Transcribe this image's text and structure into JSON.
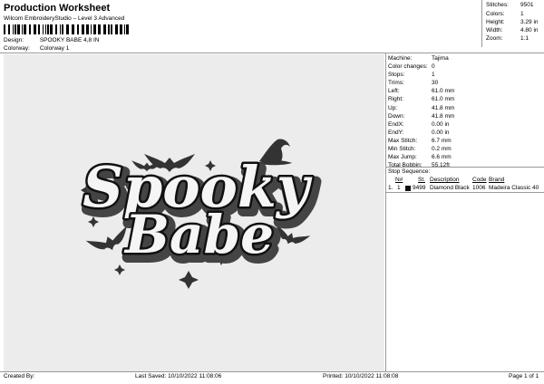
{
  "header": {
    "title": "Production Worksheet",
    "subtitle": "Wilcom EmbroideryStudio – Level 3 Advanced",
    "design_label": "Design:",
    "design_value": "SPOOKY BABE 4,8 IN",
    "colorway_label": "Colorway:",
    "colorway_value": "Colorway 1"
  },
  "summary": {
    "stitches_label": "Stitches:",
    "stitches": "9501",
    "colors_label": "Colors:",
    "colors": "1",
    "height_label": "Height:",
    "height": "3.29 in",
    "width_label": "Width:",
    "width": "4.80 in",
    "zoom_label": "Zoom:",
    "zoom": "1:1"
  },
  "stats": [
    {
      "label": "Machine:",
      "value": "Tajima"
    },
    {
      "label": "Color changes:",
      "value": "0"
    },
    {
      "label": "Stops:",
      "value": "1"
    },
    {
      "label": "Trims:",
      "value": "30"
    },
    {
      "label": "Left:",
      "value": "61.0 mm"
    },
    {
      "label": "Right:",
      "value": "61.0 mm"
    },
    {
      "label": "Up:",
      "value": "41.8 mm"
    },
    {
      "label": "Down:",
      "value": "41.8 mm"
    },
    {
      "label": "EndX:",
      "value": "0.00 in"
    },
    {
      "label": "EndY:",
      "value": "0.00 in"
    },
    {
      "label": "Max Stitch:",
      "value": "6.7 mm"
    },
    {
      "label": "Min Stitch:",
      "value": "0.2 mm"
    },
    {
      "label": "Max Jump:",
      "value": "6.6 mm"
    },
    {
      "label": "Total Bobbin:",
      "value": "55.12ft"
    }
  ],
  "stop_sequence": {
    "title": "Stop Sequence:",
    "headers": {
      "num": "N#",
      "st": "St.",
      "description": "Description",
      "code": "Code",
      "brand": "Brand"
    },
    "rows": [
      {
        "index": "1.",
        "num": "1",
        "st": "9499",
        "description": "Diamond Black",
        "code": "1006",
        "brand": "Madeira Classic 40"
      }
    ]
  },
  "design_text": {
    "line1": "Spooky",
    "line2": "Babe"
  },
  "footer": {
    "created_by": "Created By:",
    "last_saved": "Last Saved: 10/10/2022 11:08:06",
    "printed": "Printed: 10/10/2022 11:08:08",
    "page": "Page 1 of 1"
  },
  "colors": {
    "thread": "#111111",
    "fill": "#f5f5f5",
    "background": "#ececec"
  }
}
